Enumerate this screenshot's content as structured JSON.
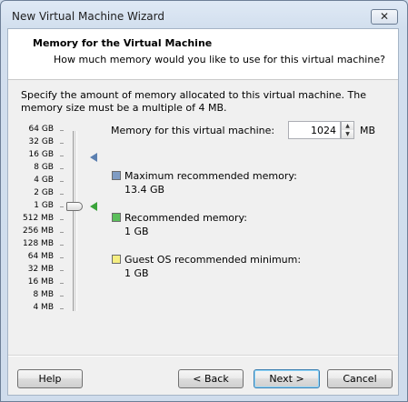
{
  "window": {
    "title": "New Virtual Machine Wizard",
    "close_glyph": "✕"
  },
  "header": {
    "title": "Memory for the Virtual Machine",
    "subtitle": "How much memory would you like to use for this virtual machine?"
  },
  "description": "Specify the amount of memory allocated to this virtual machine. The memory size must be a multiple of 4 MB.",
  "scale": {
    "labels": [
      "64 GB",
      "32 GB",
      "16 GB",
      "8 GB",
      "4 GB",
      "2 GB",
      "1 GB",
      "512 MB",
      "256 MB",
      "128 MB",
      "64 MB",
      "32 MB",
      "16 MB",
      "8 MB",
      "4 MB"
    ],
    "slider_value_label": "1 GB"
  },
  "memory": {
    "label": "Memory for this virtual machine:",
    "value": "1024",
    "unit": "MB",
    "spin_up_glyph": "▲",
    "spin_down_glyph": "▼"
  },
  "recommendations": {
    "max_label": "Maximum recommended memory:",
    "max_value": "13.4 GB",
    "rec_label": "Recommended memory:",
    "rec_value": "1 GB",
    "guest_label": "Guest OS recommended minimum:",
    "guest_value": "1 GB",
    "colors": {
      "max": "#7f9cc4",
      "rec": "#5bbf5b",
      "guest": "#f5ee82"
    }
  },
  "buttons": {
    "help": "Help",
    "back": "< Back",
    "next": "Next >",
    "cancel": "Cancel"
  }
}
